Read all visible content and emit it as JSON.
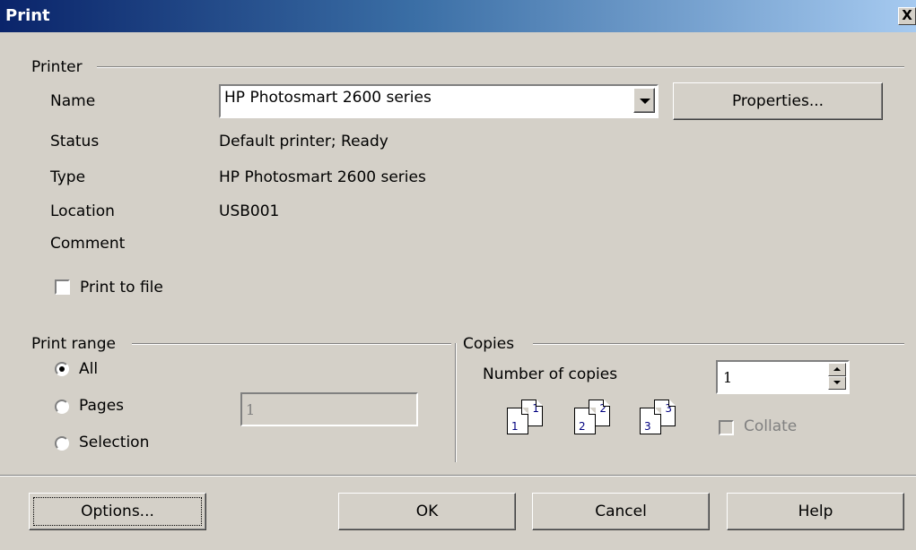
{
  "window": {
    "title": "Print",
    "close_glyph": "X"
  },
  "printer": {
    "group_label": "Printer",
    "name_label": "Name",
    "name_value": "HP Photosmart 2600 series",
    "properties_button": "Properties...",
    "status_label": "Status",
    "status_value": "Default printer; Ready",
    "type_label": "Type",
    "type_value": "HP Photosmart 2600 series",
    "location_label": "Location",
    "location_value": "USB001",
    "comment_label": "Comment",
    "print_to_file_label": "Print to file",
    "print_to_file_checked": false
  },
  "print_range": {
    "group_label": "Print range",
    "options": [
      "All",
      "Pages",
      "Selection"
    ],
    "selected": "All",
    "pages_value": "1"
  },
  "copies": {
    "group_label": "Copies",
    "number_label": "Number of copies",
    "number_value": "1",
    "collate_label": "Collate",
    "collate_checked": false,
    "collate_enabled": false,
    "page_numbers": [
      "1",
      "2",
      "3"
    ]
  },
  "buttons": {
    "options": "Options...",
    "ok": "OK",
    "cancel": "Cancel",
    "help": "Help"
  },
  "colors": {
    "titlebar_start": "#0a246a",
    "titlebar_end": "#a6caf0",
    "face": "#d4d0c8"
  }
}
